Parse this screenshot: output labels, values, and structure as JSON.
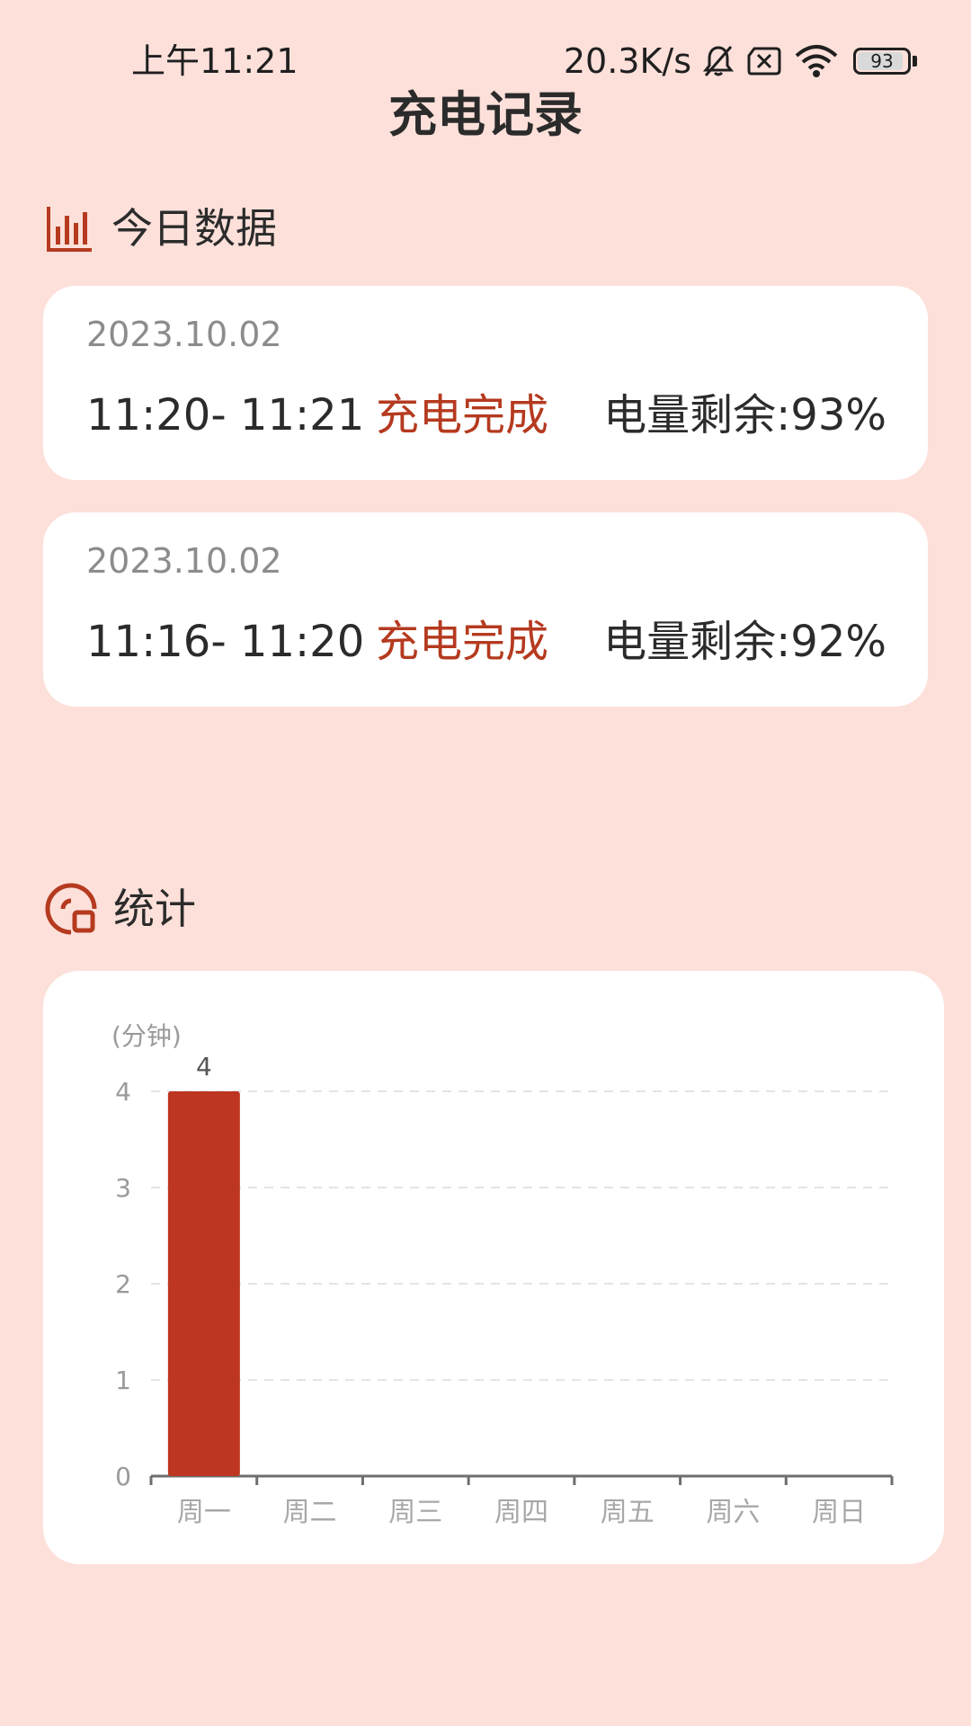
{
  "status_bar": {
    "time": "上午11:21",
    "network_speed": "20.3K/s",
    "icons": [
      "bell-muted-icon",
      "sim-disabled-icon",
      "wifi-icon"
    ],
    "battery": {
      "level": 93,
      "label": "93"
    }
  },
  "page": {
    "title": "充电记录"
  },
  "today": {
    "header": "今日数据",
    "icon": "bar-chart-icon",
    "records": [
      {
        "date": "2023.10.02",
        "time_range": "11:20- 11:21",
        "status": "充电完成",
        "remaining": "电量剩余:93%"
      },
      {
        "date": "2023.10.02",
        "time_range": "11:16- 11:20",
        "status": "充电完成",
        "remaining": "电量剩余:92%"
      }
    ]
  },
  "stats": {
    "header": "统计",
    "icon": "stats-overview-icon"
  },
  "colors": {
    "background": "#fde0da",
    "accent": "#b53a1f",
    "bar": "#bd3621",
    "card": "#ffffff"
  },
  "chart_data": {
    "type": "bar",
    "title": "",
    "xlabel": "",
    "ylabel": "(分钟)",
    "categories": [
      "周一",
      "周二",
      "周三",
      "周四",
      "周五",
      "周六",
      "周日"
    ],
    "values": [
      4,
      0,
      0,
      0,
      0,
      0,
      0
    ],
    "data_labels": [
      "4",
      "",
      "",
      "",
      "",
      "",
      ""
    ],
    "ylim": [
      0,
      4
    ],
    "yticks": [
      0,
      1,
      2,
      3,
      4
    ],
    "grid": true
  }
}
